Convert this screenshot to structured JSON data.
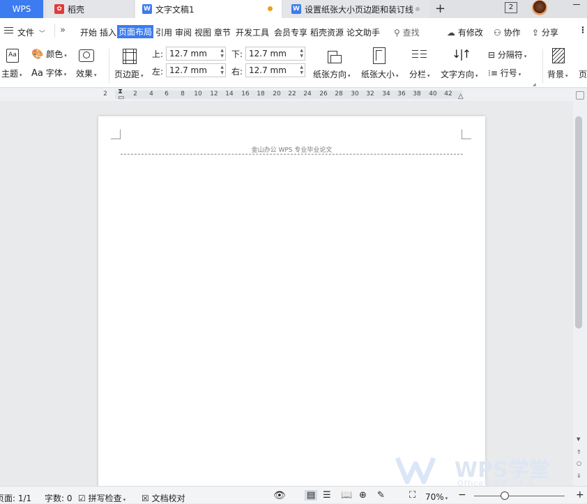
{
  "tabs": {
    "wps": "WPS",
    "daoke": "稻壳",
    "doc1": "文字文稿1",
    "doc2": "设置纸张大小页边距和装订线"
  },
  "titlebar": {
    "badge_count": "2"
  },
  "menu": {
    "file": "文件",
    "items": [
      "开始",
      "插入",
      "页面布局",
      "引用",
      "审阅",
      "视图",
      "章节",
      "开发工具",
      "会员专享",
      "稻壳资源",
      "论文助手"
    ],
    "active": "页面布局",
    "search": "查找",
    "modified": "有修改",
    "collab": "协作",
    "share": "分享"
  },
  "ribbon": {
    "theme": "主题",
    "color": "颜色",
    "font": "字体",
    "effect": "效果",
    "margin": "页边距",
    "top_label": "上:",
    "top_value": "12.7 mm",
    "bottom_label": "下:",
    "bottom_value": "12.7 mm",
    "left_label": "左:",
    "left_value": "12.7 mm",
    "right_label": "右:",
    "right_value": "12.7 mm",
    "orientation": "纸张方向",
    "size": "纸张大小",
    "columns": "分栏",
    "text_direction": "文字方向",
    "breaks": "分隔符",
    "line_numbers": "行号",
    "background": "背景",
    "page_more": "页"
  },
  "ruler": {
    "ticks": [
      "2",
      "2",
      "4",
      "6",
      "8",
      "10",
      "12",
      "14",
      "16",
      "18",
      "20",
      "22",
      "24",
      "26",
      "28",
      "30",
      "32",
      "34",
      "36",
      "38",
      "40",
      "42"
    ]
  },
  "document": {
    "header_text": "金山办公 WPS 专业毕业论文"
  },
  "status": {
    "page": "页面: 1/1",
    "words": "字数: 0",
    "spellcheck": "拼写检查",
    "proofread": "文档校对",
    "zoom": "70%"
  },
  "watermark": {
    "brand": "WPS学堂",
    "tagline": "Office技能学习平台"
  },
  "colors": {
    "accent": "#3c7bf0",
    "daoke_red": "#e23b3b",
    "modified_dot": "#e8a317"
  }
}
